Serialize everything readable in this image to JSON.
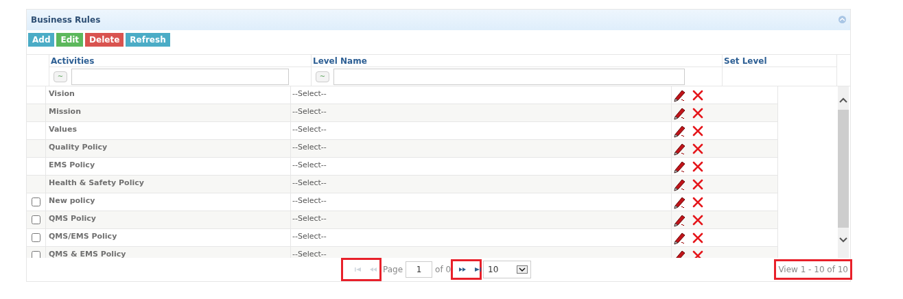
{
  "panel": {
    "title": "Business Rules",
    "collapsed": false
  },
  "toolbar": [
    {
      "label": "Add",
      "kind": "add"
    },
    {
      "label": "Edit",
      "kind": "edit"
    },
    {
      "label": "Delete",
      "kind": "delete"
    },
    {
      "label": "Refresh",
      "kind": "refresh"
    }
  ],
  "columns": [
    {
      "label": "Activities",
      "filter_operator": "~"
    },
    {
      "label": "Level Name",
      "filter_operator": "~"
    },
    {
      "label": "Set Level"
    }
  ],
  "rows": [
    {
      "activity": "Vision",
      "level_name": "--Select--"
    },
    {
      "activity": "Mission",
      "level_name": "--Select--"
    },
    {
      "activity": "Values",
      "level_name": "--Select--"
    },
    {
      "activity": "Quality Policy",
      "level_name": "--Select--"
    },
    {
      "activity": "EMS Policy",
      "level_name": "--Select--"
    },
    {
      "activity": "Health & Safety Policy",
      "level_name": "--Select--"
    },
    {
      "activity": "New policy",
      "level_name": "--Select--",
      "checked": false
    },
    {
      "activity": "QMS Policy",
      "level_name": "--Select--",
      "checked": false
    },
    {
      "activity": "QMS/EMS Policy",
      "level_name": "--Select--",
      "checked": false
    },
    {
      "activity": "QMS & EMS Policy",
      "level_name": "--Select--",
      "checked": false
    }
  ],
  "pager": {
    "first": {
      "disabled": true
    },
    "prev": {
      "disabled": true
    },
    "page_label": "Page",
    "page": "1",
    "of_label": "of 0",
    "next": {
      "disabled": false
    },
    "last": {
      "disabled": false
    },
    "page_size": "10",
    "summary": "View 1 - 10 of 10"
  }
}
